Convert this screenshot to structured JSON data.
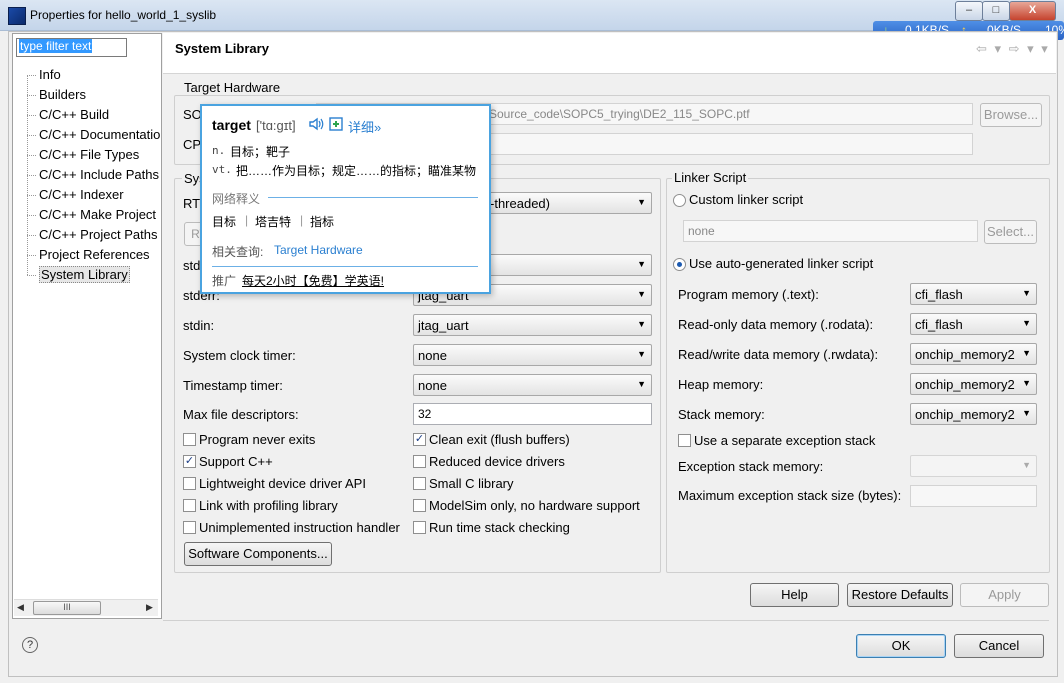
{
  "window": {
    "title": "Properties for hello_world_1_syslib",
    "minimize": "–",
    "maximize": "□",
    "close": "X"
  },
  "netwidget": {
    "down_arrow": "↓",
    "down": "0.1KB/S",
    "up_arrow": "↑",
    "up": "0KB/S",
    "pct": "10%"
  },
  "filter": {
    "placeholder": "type filter text"
  },
  "tree": {
    "items": [
      "Info",
      "Builders",
      "C/C++ Build",
      "C/C++ Documentatio",
      "C/C++ File Types",
      "C/C++ Include Paths",
      "C/C++ Indexer",
      "C/C++ Make Project",
      "C/C++ Project Paths",
      "Project References",
      "System Library"
    ]
  },
  "page": {
    "title": "System Library",
    "nav": "⇦ ▾ ⇨ ▾ ▾"
  },
  "target_hardware": {
    "label": "Target Hardware",
    "sopc_label": "SO",
    "sopc_value": "Source_code\\SOPC5_trying\\DE2_115_SOPC.ptf",
    "browse": "Browse...",
    "cpu_label": "CP"
  },
  "system": {
    "label": "Sys",
    "rtos_label": "RT",
    "rtos_value": "-threaded)",
    "rtos_btn": "RT",
    "stdout_label": "std",
    "stderr_label": "stderr:",
    "stderr_value": "jtag_uart",
    "stdin_label": "stdin:",
    "stdin_value": "jtag_uart",
    "clock_label": "System clock timer:",
    "clock_value": "none",
    "timestamp_label": "Timestamp timer:",
    "timestamp_value": "none",
    "maxfd_label": "Max file descriptors:",
    "maxfd_value": "32",
    "checkboxes": [
      {
        "label": "Program never exits",
        "checked": false
      },
      {
        "label": "Clean exit (flush buffers)",
        "checked": true
      },
      {
        "label": "Support C++",
        "checked": true
      },
      {
        "label": "Reduced device drivers",
        "checked": false
      },
      {
        "label": "Lightweight device driver API",
        "checked": false
      },
      {
        "label": "Small C library",
        "checked": false
      },
      {
        "label": "Link with profiling library",
        "checked": false
      },
      {
        "label": "ModelSim only, no hardware support",
        "checked": false
      },
      {
        "label": "Unimplemented instruction handler",
        "checked": false
      },
      {
        "label": "Run time stack checking",
        "checked": false
      }
    ],
    "sw_components": "Software Components..."
  },
  "linker": {
    "label": "Linker Script",
    "custom_label": "Custom linker script",
    "custom_value": "none",
    "select": "Select...",
    "auto_label": "Use auto-generated linker script",
    "prog_label": "Program memory (.text):",
    "prog_value": "cfi_flash",
    "ro_label": "Read-only data memory (.rodata):",
    "ro_value": "cfi_flash",
    "rw_label": "Read/write data memory (.rwdata):",
    "rw_value": "onchip_memory2",
    "heap_label": "Heap memory:",
    "heap_value": "onchip_memory2",
    "stack_label": "Stack memory:",
    "stack_value": "onchip_memory2",
    "sep_exc_label": "Use a separate exception stack",
    "exc_mem_label": "Exception stack memory:",
    "exc_max_label": "Maximum exception stack size (bytes):"
  },
  "buttons": {
    "help": "Help",
    "restore": "Restore Defaults",
    "apply": "Apply",
    "ok": "OK",
    "cancel": "Cancel",
    "help_icon": "?"
  },
  "popup": {
    "word": "target",
    "phonetic": "['tɑ:gɪt]",
    "detail": "详细»",
    "def1_pos": "n.",
    "def1": "目标；靶子",
    "def2_pos": "vt.",
    "def2": "把……作为目标；规定……的指标；瞄准某物",
    "web_title": "网络释义",
    "web_items": [
      "目标",
      "塔吉特",
      "指标"
    ],
    "related_label": "相关查询:",
    "related_link": "Target Hardware",
    "ad_label": "推广",
    "ad_text": "每天2小时【免费】学英语!"
  },
  "colors": {
    "accent": "#4aa3e0",
    "selection": "#3399ff",
    "link": "#2a7fd0"
  },
  "icons": [
    "app-icon",
    "speaker-icon",
    "add-icon",
    "help-icon",
    "arrow-down-icon",
    "arrow-up-icon"
  ]
}
